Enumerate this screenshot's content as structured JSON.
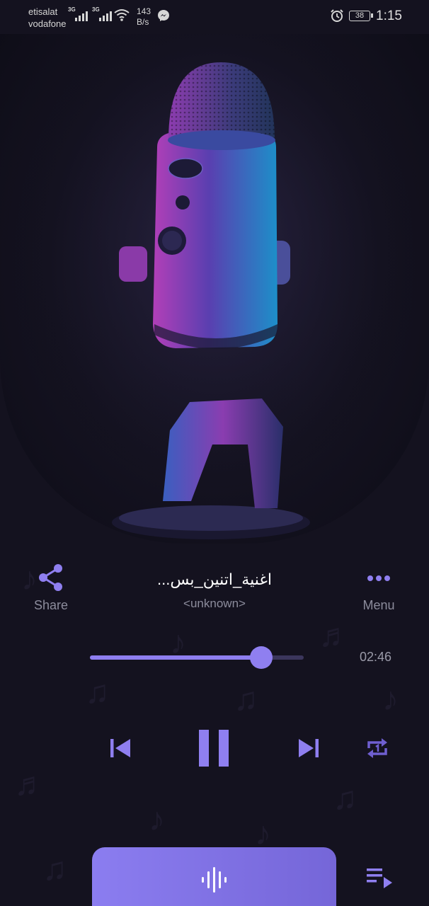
{
  "status_bar": {
    "carrier_1": "etisalat",
    "carrier_2": "vodafone",
    "network_1": "3G",
    "network_2": "3G",
    "speed_value": "143",
    "speed_unit": "B/s",
    "battery": "38",
    "time": "1:15",
    "icons": [
      "wifi-icon",
      "messenger-icon",
      "alarm-icon",
      "battery-icon"
    ]
  },
  "player": {
    "title": "اغنية_اتنين_بس...",
    "artist": "<unknown>",
    "share_label": "Share",
    "menu_label": "Menu",
    "duration": "02:46",
    "progress": 0.8
  },
  "controls": {
    "icons": [
      "previous-icon",
      "pause-icon",
      "next-icon",
      "repeat-one-icon",
      "waveform-icon",
      "queue-icon"
    ]
  },
  "colors": {
    "accent": "#8f7ff0",
    "background": "#14121f",
    "muted_text": "#8c8c9c"
  }
}
